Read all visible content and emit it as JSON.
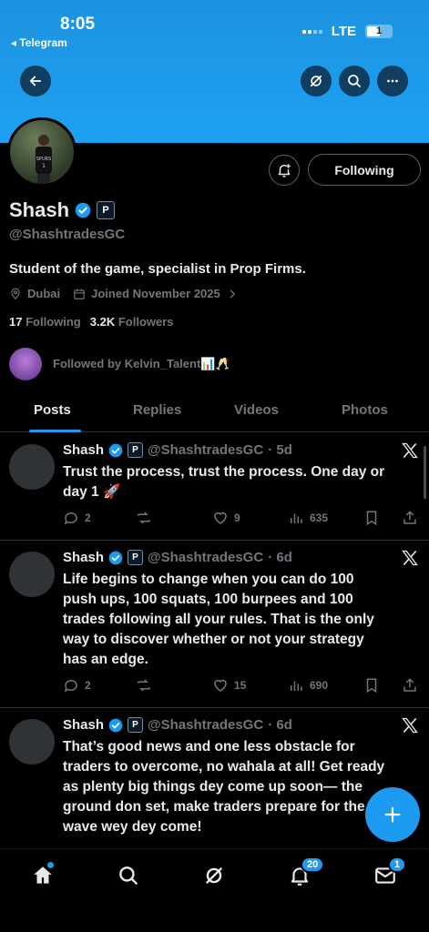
{
  "status_bar": {
    "time": "8:05",
    "back_app": "◂ Telegram",
    "network": "LTE",
    "battery": "1"
  },
  "profile": {
    "name": "Shash",
    "badge_text": "P",
    "handle": "@ShashtradesGC",
    "bio": "Student of the game, specialist in Prop Firms.",
    "location": "Dubai",
    "joined": "Joined November 2025",
    "following_count": "17",
    "following_label": "Following",
    "followers_count": "3.2K",
    "followers_label": "Followers",
    "followed_by": "Followed by Kelvin_Talent📊🥂",
    "following_button": "Following"
  },
  "tabs": [
    "Posts",
    "Replies",
    "Videos",
    "Photos"
  ],
  "tweets": [
    {
      "name": "Shash",
      "badge": "P",
      "handle": "@ShashtradesGC",
      "time": "· 5d",
      "text": "Trust the process, trust the process. One day or day 1 🚀",
      "replies": "2",
      "retweets": "",
      "likes": "9",
      "views": "635"
    },
    {
      "name": "Shash",
      "badge": "P",
      "handle": "@ShashtradesGC",
      "time": "· 6d",
      "text": "Life begins to change when you can do 100 push ups, 100 squats, 100 burpees and 100 trades following all your rules. That is the only way to discover whether or not your strategy has an edge.",
      "replies": "2",
      "retweets": "",
      "likes": "15",
      "views": "690"
    },
    {
      "name": "Shash",
      "badge": "P",
      "handle": "@ShashtradesGC",
      "time": "· 6d",
      "text": "That’s good news and one less obstacle for traders to overcome, no wahala at all! Get ready as plenty big things dey come up soon— the ground don set, make traders prepare for the wave wey dey come!",
      "replies": "",
      "retweets": "",
      "likes": "",
      "views": ""
    }
  ],
  "nav": {
    "notifications_badge": "20",
    "messages_badge": "1"
  },
  "colors": {
    "accent": "#1d9bf0",
    "banner": "#1da1f2",
    "muted": "#71767b"
  }
}
